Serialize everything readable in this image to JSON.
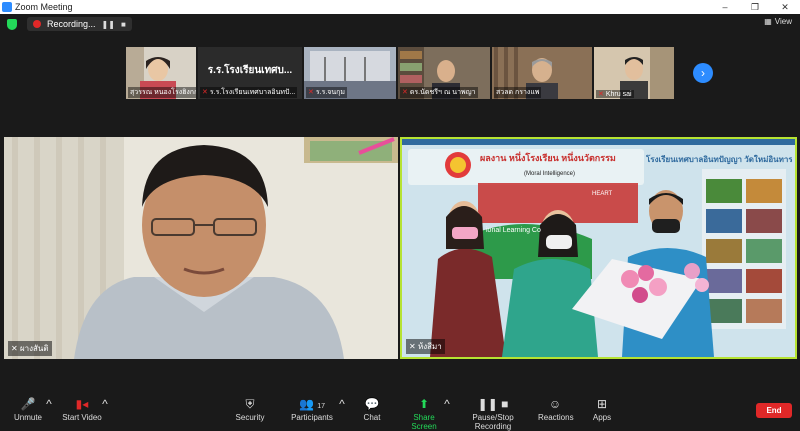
{
  "window": {
    "title": "Zoom Meeting",
    "minimize": "–",
    "restore": "❐",
    "close": "✕"
  },
  "meeting": {
    "recording_label": "Recording...",
    "pause_icon": "❚❚",
    "stop_icon": "■",
    "view_label": "View"
  },
  "gallery": {
    "participants": [
      {
        "name": "สุวรรณ หนองโรงฮิงกก",
        "muted": false
      },
      {
        "name": "ร.ร.โรงเรียนเทศบาลอินทปั...",
        "muted": true,
        "overlay_text": "ร.ร.โรงเรียนเทศบ..."
      },
      {
        "name": "ร.ร.จนกุม",
        "muted": true
      },
      {
        "name": "ดร.นัดชรีฯ ณ นาพญา",
        "muted": true
      },
      {
        "name": "สวลด กรางแพ",
        "muted": false
      },
      {
        "name": "Khru sai",
        "muted": true
      }
    ],
    "next_icon": "›"
  },
  "main_tiles": {
    "left": {
      "name": "ผางสันติ"
    },
    "right": {
      "name": "ห้งสีมา",
      "banner_left": "ผลงาน หนึ่งโรงเรียน หนึ่งนวัตกรรม",
      "banner_sub": "(Moral Intelligence)",
      "banner_sub2": "HEART",
      "banner_right": "โรงเรียนเทศบาลอินทปัญญา วัดใหม่อินทาร",
      "logo_text": "ional Learning Co"
    }
  },
  "toolbar": {
    "unmute": "Unmute",
    "start_video": "Start Video",
    "security": "Security",
    "participants": "Participants",
    "participants_count": "17",
    "chat": "Chat",
    "share_screen": "Share Screen",
    "recording": "Pause/Stop Recording",
    "reactions": "Reactions",
    "apps": "Apps",
    "end": "End"
  },
  "colors": {
    "accent": "#2d8cff",
    "end": "#e02828",
    "active_border": "#b6e332",
    "share": "#23d959"
  }
}
